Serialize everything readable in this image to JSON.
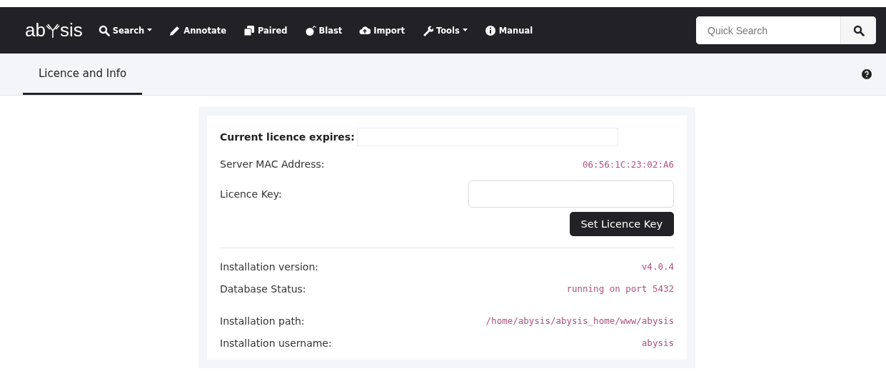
{
  "navbar": {
    "logo": {
      "before": "ab",
      "after": "sis"
    },
    "items": [
      {
        "kind": "search",
        "label": "Search",
        "dropdown": true
      },
      {
        "kind": "pencil",
        "label": "Annotate",
        "dropdown": false
      },
      {
        "kind": "copy",
        "label": "Paired",
        "dropdown": false
      },
      {
        "kind": "bomb",
        "label": "Blast",
        "dropdown": false
      },
      {
        "kind": "upload",
        "label": "Import",
        "dropdown": false
      },
      {
        "kind": "wrench",
        "label": "Tools",
        "dropdown": true
      },
      {
        "kind": "info",
        "label": "Manual",
        "dropdown": false
      }
    ],
    "quick_search": {
      "placeholder": "Quick Search"
    }
  },
  "tabs": [
    {
      "label": "Licence and Info",
      "selected": true
    }
  ],
  "licence": {
    "expires_label": "Current licence expires:",
    "mac_label": "Server MAC Address:",
    "mac_value": "06:56:1C:23:02:A6",
    "key_label": "Licence Key:",
    "button": "Set Licence Key"
  },
  "info": [
    {
      "label": "Installation version:",
      "value": "v4.0.4"
    },
    {
      "label": "Database Status:",
      "value": "running on port 5432"
    },
    {
      "label": "Installation path:",
      "value": "/home/abysis/abysis_home/www/abysis"
    },
    {
      "label": "Installation username:",
      "value": "abysis"
    }
  ]
}
